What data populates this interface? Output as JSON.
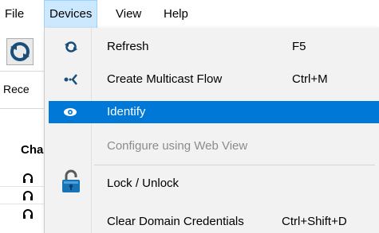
{
  "menubar": {
    "file": "File",
    "devices": "Devices",
    "view": "View",
    "help": "Help"
  },
  "background": {
    "tab_fragment": "Rece",
    "column_fragment": "Cha"
  },
  "dropdown": {
    "items": [
      {
        "label": "Refresh",
        "shortcut": "F5",
        "icon": "refresh-icon",
        "disabled": false,
        "highlighted": false
      },
      {
        "label": "Create Multicast Flow",
        "shortcut": "Ctrl+M",
        "icon": "multicast-flow-icon",
        "disabled": false,
        "highlighted": false
      },
      {
        "label": "Identify",
        "shortcut": "",
        "icon": "eye-icon",
        "disabled": false,
        "highlighted": true
      },
      {
        "label": "Configure using Web View",
        "shortcut": "",
        "icon": "",
        "disabled": true,
        "highlighted": false
      },
      {
        "label": "Lock / Unlock",
        "shortcut": "",
        "icon": "padlock-icon",
        "disabled": false,
        "highlighted": false
      },
      {
        "label": "Clear Domain Credentials",
        "shortcut": "Ctrl+Shift+D",
        "icon": "",
        "disabled": false,
        "highlighted": false
      }
    ]
  },
  "colors": {
    "highlight": "#0078d7",
    "menu_background": "#f2f2f2",
    "devices_active": "#cce8ff",
    "disabled_text": "#8c8c8c"
  }
}
